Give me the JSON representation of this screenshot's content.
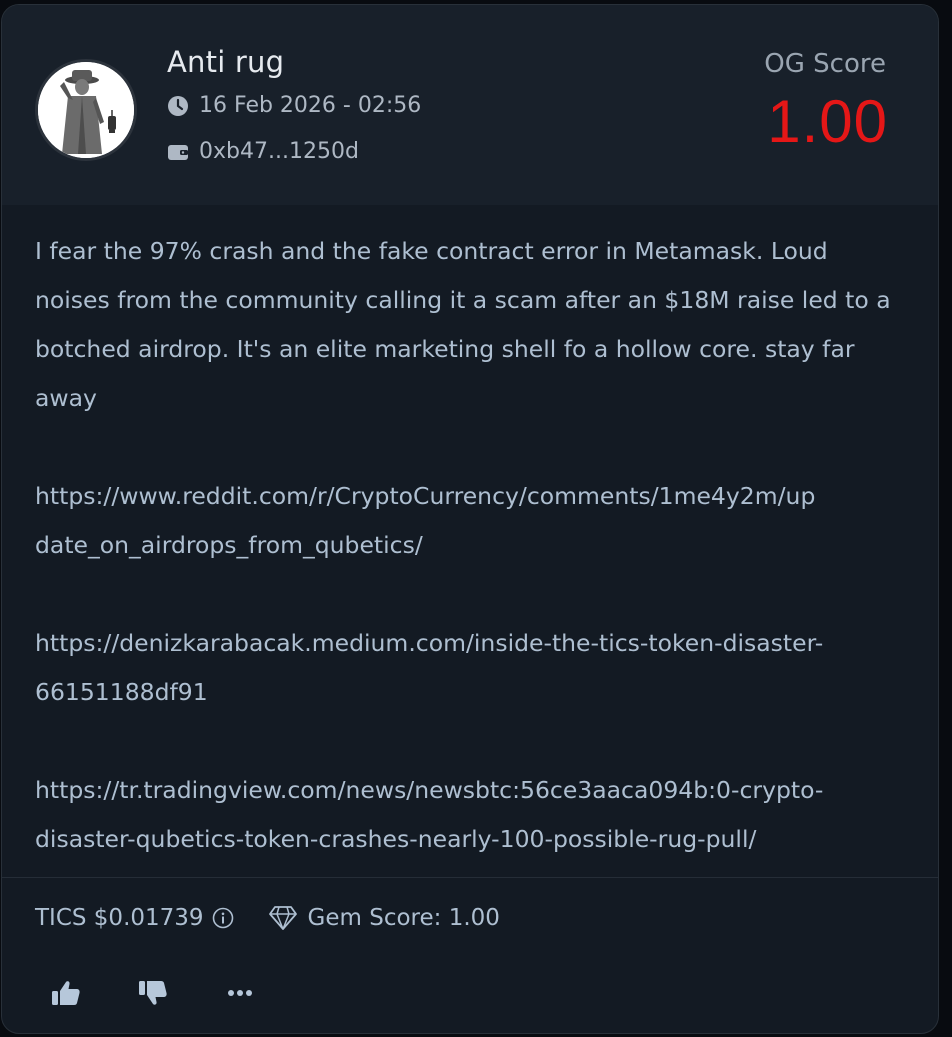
{
  "post": {
    "author": "Anti rug",
    "date": "16 Feb 2026 - 02:56",
    "wallet": "0xb47...1250d",
    "og_score_label": "OG Score",
    "og_score_value": "1.00",
    "body": {
      "paragraph": "I fear the 97% crash and the fake contract error in Metamask. Loud noises from the community calling it a scam after an $18M raise led to a botched airdrop. It's an elite marketing shell fo a hollow core. stay far away",
      "link1_line1": "https://www.reddit.com/r/CryptoCurrency/comments/1me4y2m/up",
      "link1_line2": "date_on_airdrops_from_qubetics/",
      "link2_line1": "https://denizkarabacak.medium.com/inside-the-tics-token-disaster-",
      "link2_line2": "66151188df91",
      "link3_line1": "https://tr.tradingview.com/news/newsbtc:56ce3aaca094b:0-crypto-",
      "link3_line2": "disaster-qubetics-token-crashes-nearly-100-possible-rug-pull/"
    },
    "token_price": "TICS $0.01739",
    "gem_score": "Gem Score: 1.00"
  },
  "icons": {
    "date": "clock-icon",
    "wallet": "wallet-icon",
    "info": "info-icon",
    "gem": "gem-icon",
    "like": "thumbs-up-icon",
    "dislike": "thumbs-down-icon",
    "more": "more-icon"
  },
  "colors": {
    "card_bg": "#131a23",
    "header_bg": "#18202a",
    "og_score": "#e51717",
    "text": "#aebfd1"
  }
}
